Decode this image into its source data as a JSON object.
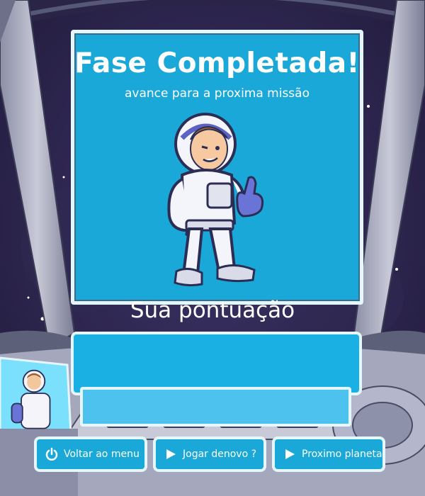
{
  "panel": {
    "title": "Fase Completada!",
    "subtitle": "avance para a proxima missão"
  },
  "score": {
    "label": "Sua pontuação",
    "value": ""
  },
  "buttons": [
    {
      "label": "Voltar ao menu",
      "icon": "power-icon"
    },
    {
      "label": "Jogar denovo ?",
      "icon": "play-icon"
    },
    {
      "label": "Proximo planeta",
      "icon": "play-icon"
    }
  ],
  "colors": {
    "panel": "#1aa8d8",
    "border": "#e6f6fd",
    "space": "#2a2244"
  }
}
